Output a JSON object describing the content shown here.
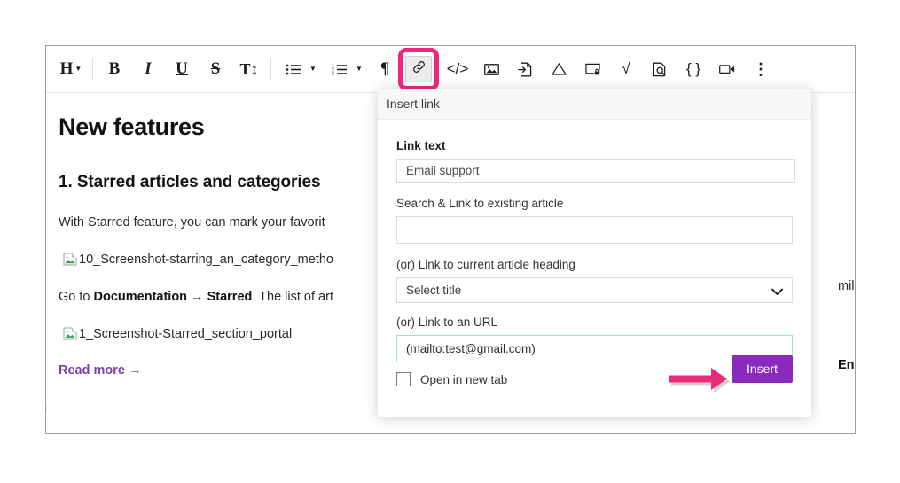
{
  "editor": {
    "toolbar": {
      "items": [
        {
          "name": "heading-select",
          "label": "H",
          "icon": "heading-dropdown-icon",
          "has_caret": true
        },
        {
          "name": "bold-button",
          "label": "B",
          "icon": "bold-icon"
        },
        {
          "name": "italic-button",
          "label": "I",
          "icon": "italic-icon"
        },
        {
          "name": "underline-button",
          "label": "U",
          "icon": "underline-icon"
        },
        {
          "name": "strikethrough-button",
          "label": "S",
          "icon": "strikethrough-icon"
        },
        {
          "name": "text-size-button",
          "label": "T↕",
          "icon": "text-size-icon"
        },
        {
          "name": "bullet-list-button",
          "label": "",
          "icon": "bullet-list-icon",
          "has_caret": true
        },
        {
          "name": "numbered-list-button",
          "label": "",
          "icon": "numbered-list-icon",
          "has_caret": true
        },
        {
          "name": "paragraph-button",
          "label": "¶",
          "icon": "pilcrow-icon"
        },
        {
          "name": "insert-link-button",
          "label": "",
          "icon": "link-icon",
          "active": true,
          "highlighted": true
        },
        {
          "name": "inline-code-button",
          "label": "</>",
          "icon": "inline-code-icon"
        },
        {
          "name": "insert-image-button",
          "label": "",
          "icon": "image-icon"
        },
        {
          "name": "insert-file-button",
          "label": "",
          "icon": "insert-file-icon"
        },
        {
          "name": "callout-button",
          "label": "",
          "icon": "warning-triangle-icon"
        },
        {
          "name": "private-content-button",
          "label": "",
          "icon": "locked-content-icon"
        },
        {
          "name": "math-button",
          "label": "√",
          "icon": "square-root-icon"
        },
        {
          "name": "article-preview-button",
          "label": "",
          "icon": "document-search-icon"
        },
        {
          "name": "code-block-button",
          "label": "{ }",
          "icon": "code-block-icon"
        },
        {
          "name": "insert-video-button",
          "label": "",
          "icon": "video-camera-icon"
        },
        {
          "name": "more-options-button",
          "label": "⋮",
          "icon": "vertical-dots-icon"
        }
      ]
    },
    "article": {
      "title": "New features",
      "section_heading": "1. Starred articles and categories",
      "paragraph_1": "With Starred feature, you can mark your favorit",
      "paragraph_1_clipped_tail": "milar t",
      "image_1_alt": "10_Screenshot-starring_an_category_metho",
      "paragraph_2_prefix": "Go to ",
      "paragraph_2_bold_1": "Documentation",
      "paragraph_2_arrow": " → ",
      "paragraph_2_bold_2": "Starred",
      "paragraph_2_suffix": ". The list of art",
      "paragraph_2_clipped_tail": "Entity",
      "image_2_alt": "1_Screenshot-Starred_section_portal",
      "read_more_label": "Read more →"
    }
  },
  "link_dialog": {
    "header_title": "Insert link",
    "link_text": {
      "label": "Link text",
      "value": "Email support",
      "placeholder": ""
    },
    "search_article": {
      "label": "Search & Link to existing article",
      "value": "",
      "placeholder": ""
    },
    "article_heading": {
      "label": "(or) Link to current article heading",
      "selected": "Select title",
      "options": [
        "Select title"
      ]
    },
    "url": {
      "label": "(or) Link to an URL",
      "value": "(mailto:test@gmail.com)",
      "placeholder": "",
      "focused": true
    },
    "open_in_new_tab": {
      "label": "Open in new tab",
      "checked": false
    },
    "insert_button_label": "Insert"
  },
  "annotation": {
    "arrow_target": "insert-button",
    "arrow_color": "#ec2a7b",
    "highlight_color": "#f0257e"
  },
  "colors": {
    "accent_purple": "#8a2bbd",
    "link_purple": "#7b3fa8",
    "annotation_pink": "#ec2a7b",
    "focus_green": "#9fe0bf",
    "border_gray": "#dcdcdc"
  }
}
